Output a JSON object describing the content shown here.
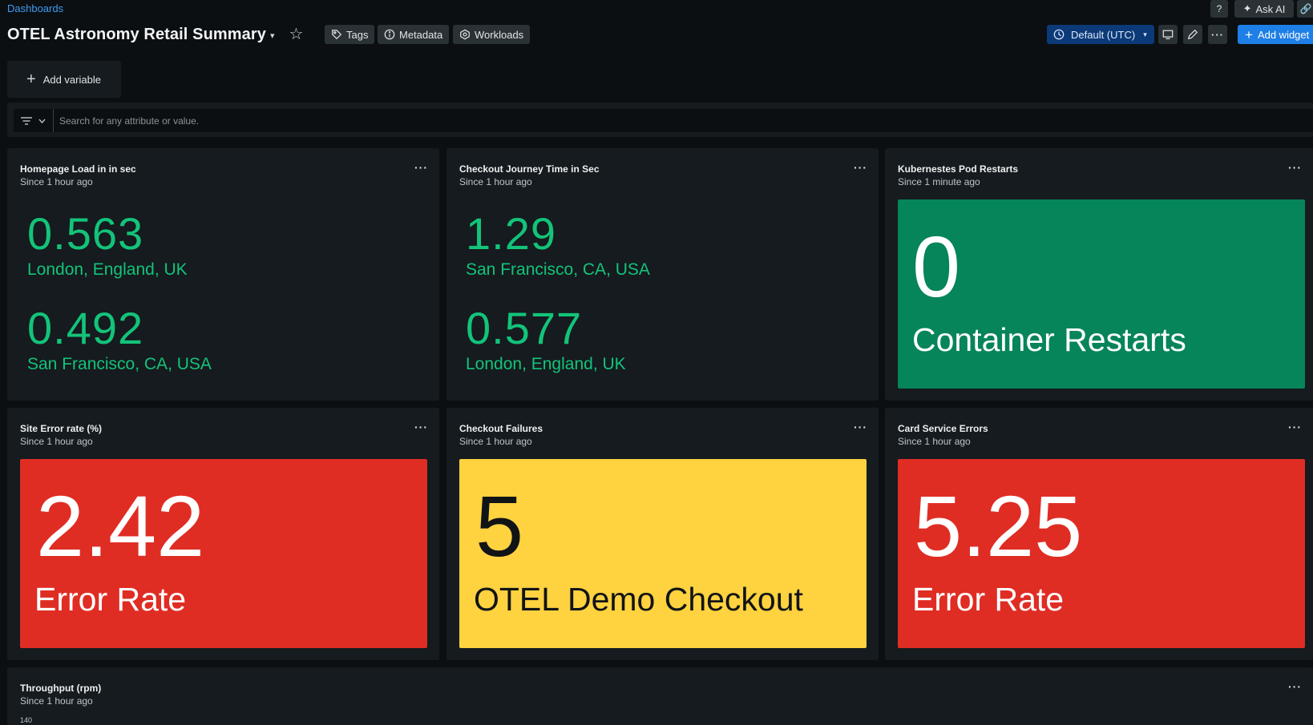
{
  "header": {
    "breadcrumb": "Dashboards",
    "title": "OTEL Astronomy Retail Summary",
    "tags_label": "Tags",
    "metadata_label": "Metadata",
    "workloads_label": "Workloads",
    "ask_ai_label": "Ask AI",
    "help_icon": "help-circle-icon",
    "timezone_label": "Default (UTC)",
    "add_widget_label": "Add widget"
  },
  "variables": {
    "add_label": "Add variable"
  },
  "filter": {
    "placeholder": "Search for any attribute or value."
  },
  "widgets": {
    "homepage": {
      "title": "Homepage Load in in sec",
      "subtitle": "Since 1 hour ago",
      "rows": [
        {
          "value": "0.563",
          "label": "London, England, UK"
        },
        {
          "value": "0.492",
          "label": "San Francisco, CA, USA"
        }
      ]
    },
    "checkout_time": {
      "title": "Checkout Journey Time in Sec",
      "subtitle": "Since 1 hour ago",
      "rows": [
        {
          "value": "1.29",
          "label": "San Francisco, CA, USA"
        },
        {
          "value": "0.577",
          "label": "London, England, UK"
        }
      ]
    },
    "pod_restarts": {
      "title": "Kubernestes Pod Restarts",
      "subtitle": "Since 1 minute ago",
      "value": "0",
      "label": "Container Restarts",
      "color": "#06845a"
    },
    "site_error": {
      "title": "Site Error rate (%)",
      "subtitle": "Since 1 hour ago",
      "value": "2.42",
      "label": "Error Rate",
      "color": "#df2d24"
    },
    "checkout_failures": {
      "title": "Checkout Failures",
      "subtitle": "Since 1 hour ago",
      "value": "5",
      "label": "OTEL Demo Checkout",
      "color": "#ffd23f"
    },
    "card_errors": {
      "title": "Card Service Errors",
      "subtitle": "Since 1 hour ago",
      "value": "5.25",
      "label": "Error Rate",
      "color": "#df2d24"
    },
    "throughput": {
      "title": "Throughput (rpm)",
      "subtitle": "Since 1 hour ago",
      "axis_top": "140"
    }
  },
  "colors": {
    "accent": "#1e7fe6",
    "billboard_green": "#13c37a",
    "background": "#0b0f12",
    "panel": "#151b1e"
  }
}
